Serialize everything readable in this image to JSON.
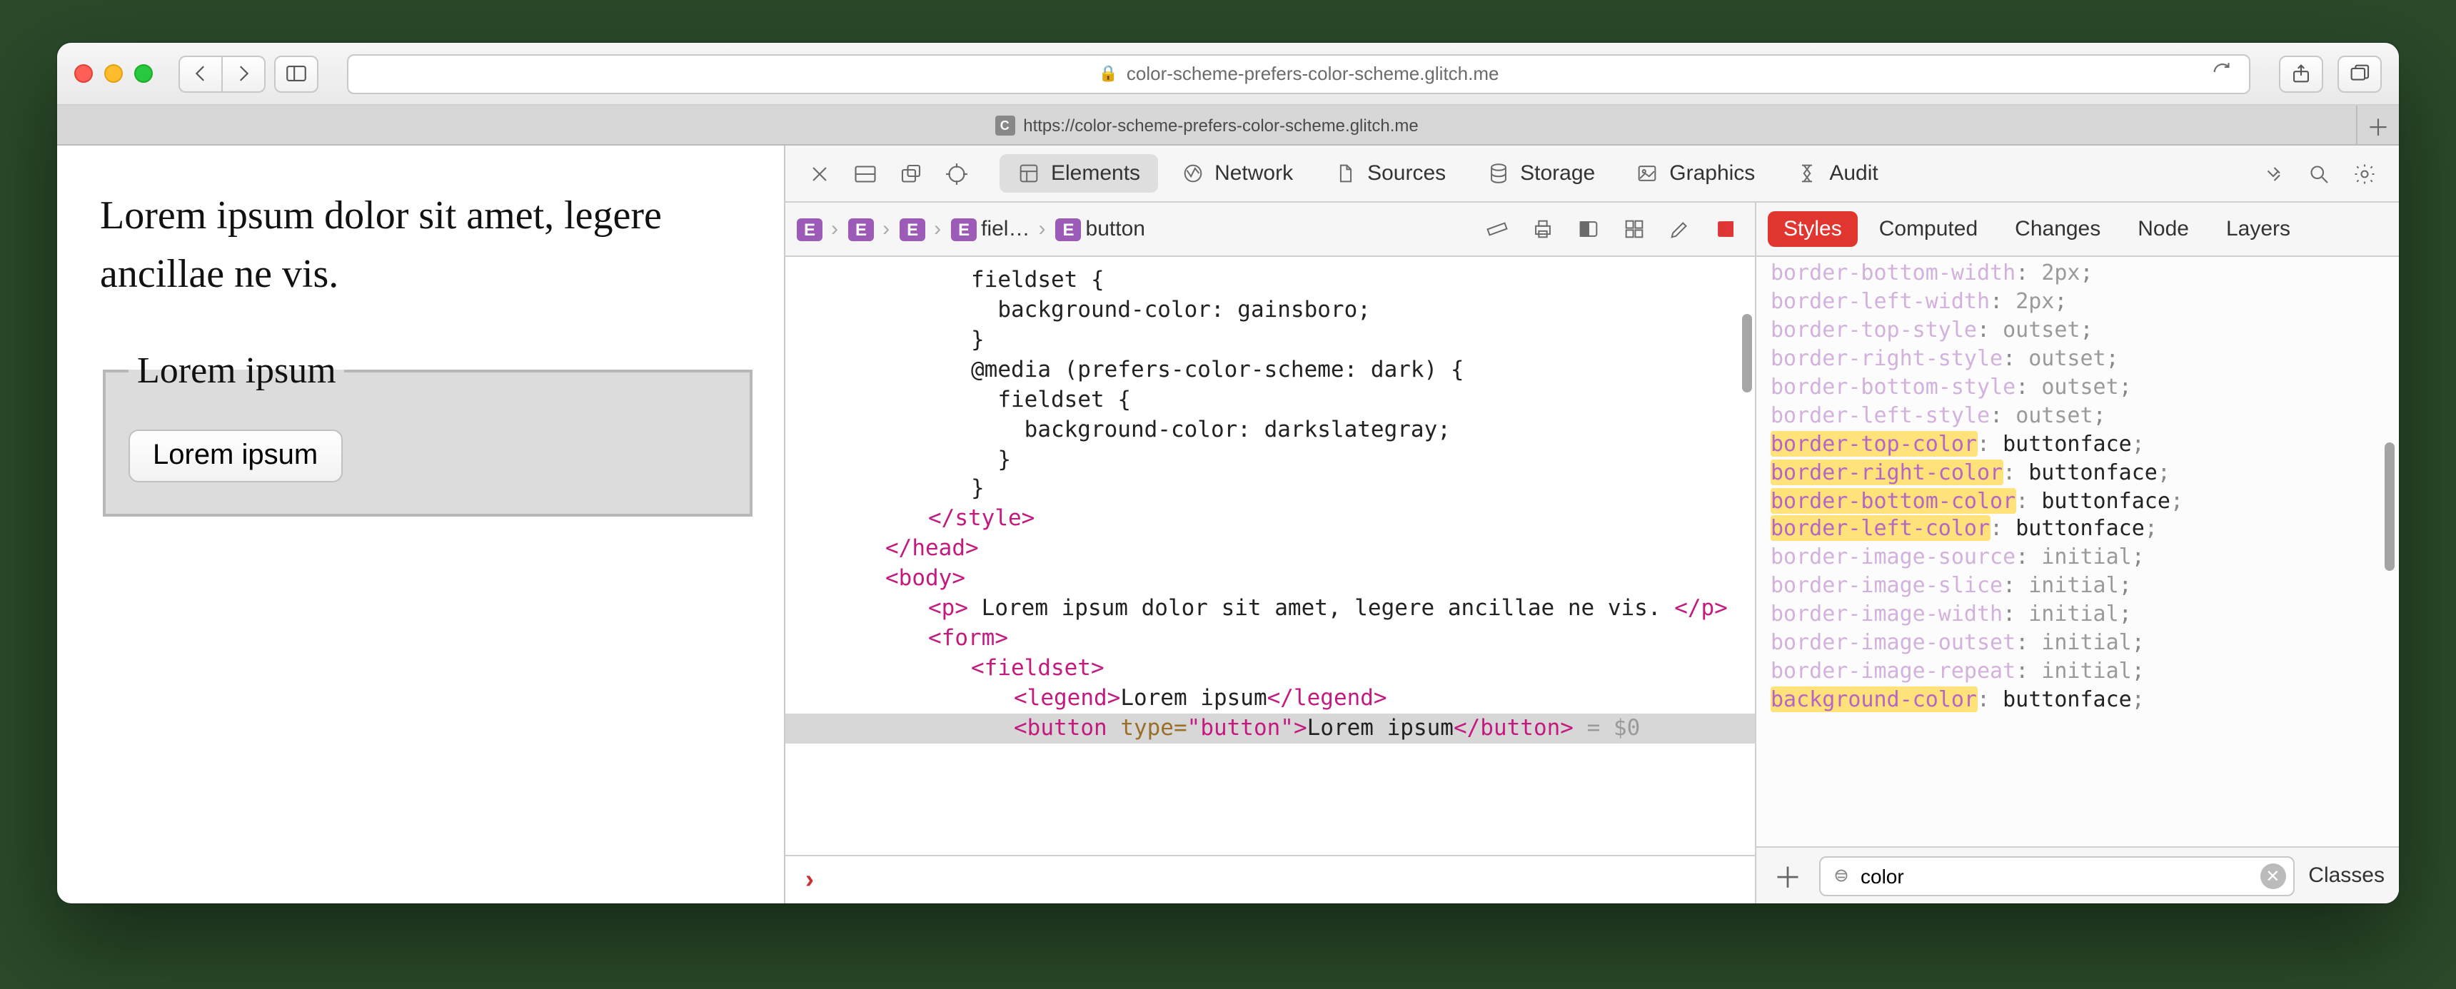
{
  "titlebar": {
    "address_host": "color-scheme-prefers-color-scheme.glitch.me",
    "tab_url": "https://color-scheme-prefers-color-scheme.glitch.me",
    "tab_favicon_letter": "C"
  },
  "devtools": {
    "tabs": {
      "elements": "Elements",
      "network": "Network",
      "sources": "Sources",
      "storage": "Storage",
      "graphics": "Graphics",
      "audit": "Audit"
    },
    "crumbs": [
      "E",
      "E",
      "E",
      "E",
      "fiel…",
      "E",
      "button"
    ],
    "right_tabs": {
      "styles": "Styles",
      "computed": "Computed",
      "changes": "Changes",
      "node": "Node",
      "layers": "Layers"
    },
    "filter_value": "color",
    "classes_label": "Classes"
  },
  "page": {
    "paragraph": "Lorem ipsum dolor sit amet, legere ancillae ne vis.",
    "legend": "Lorem ipsum",
    "button": "Lorem ipsum"
  },
  "dom": {
    "l1": "fieldset {",
    "l2": "  background-color: gainsboro;",
    "l3": "}",
    "l4": "@media (prefers-color-scheme: dark) {",
    "l5": "  fieldset {",
    "l6": "    background-color: darkslategray;",
    "l7": "  }",
    "l8": "}",
    "style_close": "</style>",
    "head_close": "</head>",
    "body_open": "<body>",
    "p_line": "<p> Lorem ipsum dolor sit amet, legere ancillae ne vis. </p>",
    "form_open": "<form>",
    "fieldset_open": "<fieldset>",
    "legend_line": "<legend>Lorem ipsum</legend>",
    "button_line_open": "<button type=\"button\">",
    "button_text": "Lorem ipsum",
    "button_line_close": "</button>",
    "eq0": " = $0"
  },
  "styles": [
    {
      "prop": "border-bottom-width",
      "val": "2px",
      "hi": false,
      "faded": true
    },
    {
      "prop": "border-left-width",
      "val": "2px",
      "hi": false,
      "faded": true
    },
    {
      "prop": "border-top-style",
      "val": "outset",
      "hi": false,
      "faded": true
    },
    {
      "prop": "border-right-style",
      "val": "outset",
      "hi": false,
      "faded": true
    },
    {
      "prop": "border-bottom-style",
      "val": "outset",
      "hi": false,
      "faded": true
    },
    {
      "prop": "border-left-style",
      "val": "outset",
      "hi": false,
      "faded": true
    },
    {
      "prop": "border-top-color",
      "val": "buttonface",
      "hi": true,
      "faded": false
    },
    {
      "prop": "border-right-color",
      "val": "buttonface",
      "hi": true,
      "faded": false
    },
    {
      "prop": "border-bottom-color",
      "val": "buttonface",
      "hi": true,
      "faded": false
    },
    {
      "prop": "border-left-color",
      "val": "buttonface",
      "hi": true,
      "faded": false
    },
    {
      "prop": "border-image-source",
      "val": "initial",
      "hi": false,
      "faded": true
    },
    {
      "prop": "border-image-slice",
      "val": "initial",
      "hi": false,
      "faded": true
    },
    {
      "prop": "border-image-width",
      "val": "initial",
      "hi": false,
      "faded": true
    },
    {
      "prop": "border-image-outset",
      "val": "initial",
      "hi": false,
      "faded": true
    },
    {
      "prop": "border-image-repeat",
      "val": "initial",
      "hi": false,
      "faded": true
    },
    {
      "prop": "background-color",
      "val": "buttonface",
      "hi": true,
      "faded": false
    }
  ]
}
